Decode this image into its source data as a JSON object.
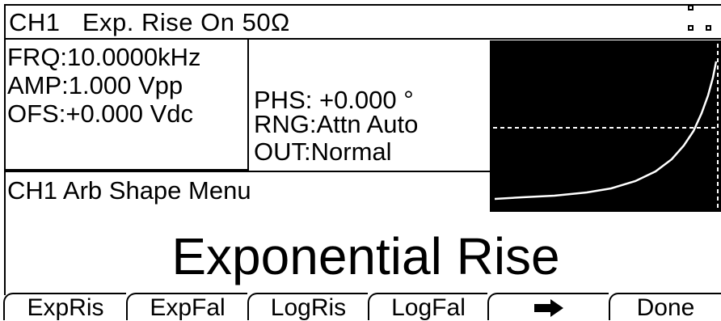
{
  "header": {
    "title": "CH1   Exp. Rise On 50Ω",
    "status_icon": "quad-square-indicator-icon"
  },
  "parameters": {
    "frequency": "FRQ:10.0000kHz",
    "amplitude": "AMP:1.000 Vpp",
    "offset": "OFS:+0.000 Vdc",
    "phase": "PHS: +0.000 °",
    "range": "RNG:Attn Auto",
    "output": "OUT:Normal"
  },
  "waveform_preview": {
    "shape": "exponential-rise",
    "trace_color": "#ffffff",
    "background": "#000000"
  },
  "menu": {
    "title": "CH1 Arb Shape Menu",
    "selected_shape": "Exponential Rise"
  },
  "softkeys": {
    "k1": "ExpRis",
    "k2": "ExpFal",
    "k3": "LogRis",
    "k4": "LogFal",
    "k5_icon": "right-arrow-icon",
    "k6": "Done"
  }
}
